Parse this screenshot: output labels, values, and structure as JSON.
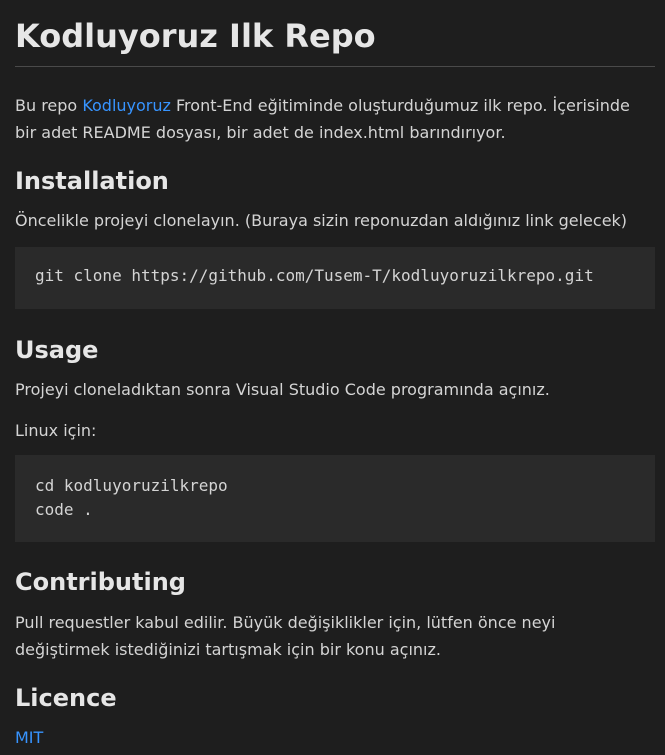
{
  "title": "Kodluyoruz Ilk Repo",
  "intro": {
    "before": "Bu repo ",
    "link": "Kodluyoruz",
    "after": " Front-End eğitiminde oluşturduğumuz ilk repo. İçerisinde bir adet README dosyası, bir adet de index.html barındırıyor."
  },
  "installation": {
    "heading": "Installation",
    "text": "Öncelikle projeyi clonelayın. (Buraya sizin reponuzdan aldığınız link gelecek)",
    "code": [
      "git clone https://github.com/Tusem-T/kodluyoruzilkrepo.git"
    ]
  },
  "usage": {
    "heading": "Usage",
    "text": "Projeyi cloneladıktan sonra Visual Studio Code programında açınız.",
    "linux": "Linux için:",
    "code": [
      "cd kodluyoruzilkrepo",
      "code ."
    ]
  },
  "contributing": {
    "heading": "Contributing",
    "text": "Pull requestler kabul edilir. Büyük değişiklikler için, lütfen önce neyi değiştirmek istediğinizi tartışmak için bir konu açınız."
  },
  "licence": {
    "heading": "Licence",
    "link": "MIT"
  }
}
